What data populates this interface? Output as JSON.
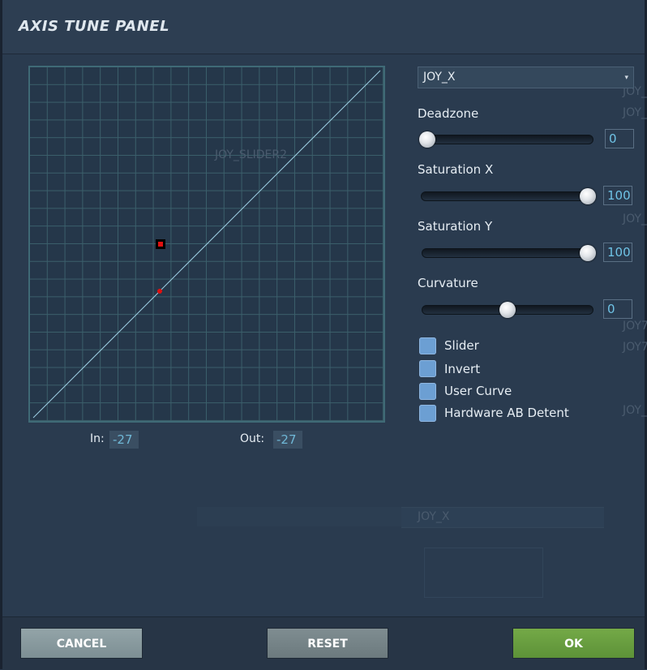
{
  "window": {
    "title": "AXIS TUNE PANEL"
  },
  "background_ghosts": {
    "graph_text": "JOY_SLIDER2",
    "row_text": "JOY_X",
    "right_1": "JOY_",
    "right_2": "JOY_",
    "right_3": "JOY_",
    "right_4": "JOY7",
    "right_5": "JOY7",
    "right_6": "JOY_"
  },
  "graph": {
    "in_label": "In:",
    "in_value": "-27",
    "out_label": "Out:",
    "out_value": "-27",
    "curve": {
      "type": "line",
      "x": [
        -100,
        100
      ],
      "y": [
        -100,
        100
      ]
    },
    "current_point": {
      "in": -27,
      "out": -27
    }
  },
  "axis_select": {
    "value": "JOY_X"
  },
  "controls": {
    "deadzone": {
      "label": "Deadzone",
      "value": "0",
      "level": 0
    },
    "saturation_x": {
      "label": "Saturation X",
      "value": "100",
      "level": 100
    },
    "saturation_y": {
      "label": "Saturation Y",
      "value": "100",
      "level": 100
    },
    "curvature": {
      "label": "Curvature",
      "value": "0",
      "level": 50
    }
  },
  "checkboxes": [
    {
      "label": "Slider",
      "checked": false
    },
    {
      "label": "Invert",
      "checked": false
    },
    {
      "label": "User Curve",
      "checked": false
    },
    {
      "label": "Hardware AB Detent",
      "checked": false
    }
  ],
  "buttons": {
    "cancel": "CANCEL",
    "reset": "RESET",
    "ok": "OK"
  },
  "colors": {
    "ok": "#5d9238",
    "accent_value": "#6fc3e6",
    "grid": "#3b5f6b"
  }
}
